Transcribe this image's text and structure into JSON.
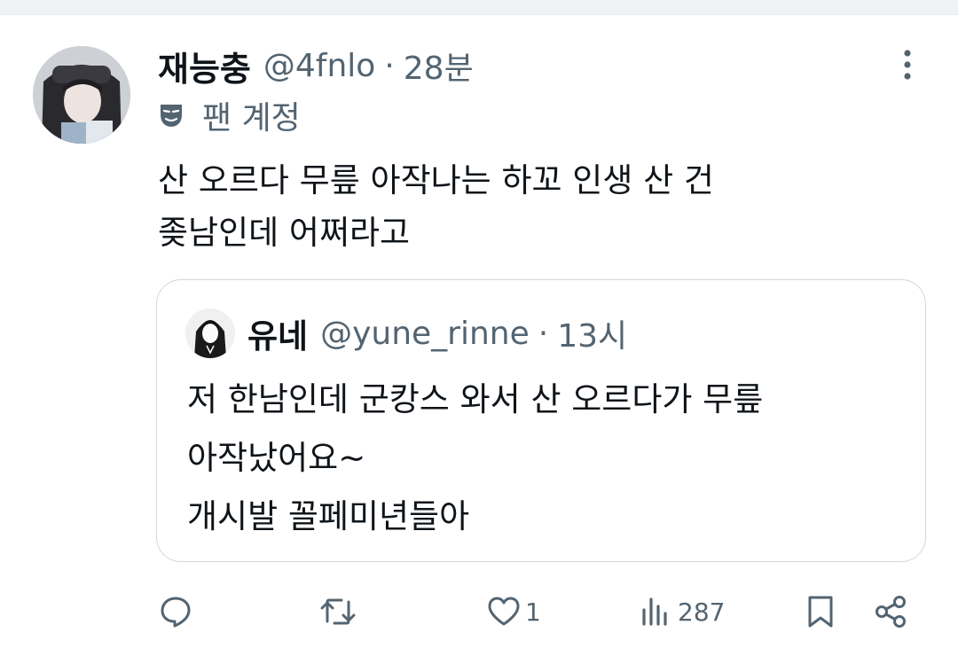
{
  "tweet": {
    "display_name": "재능충",
    "handle": "@4fnlo",
    "separator": "·",
    "time": "28분",
    "badge": "팬 계정",
    "text_lines": [
      "산 오르다 무릎 아작나는 하꼬 인생 산 건",
      "좆남인데 어쩌라고"
    ]
  },
  "quote": {
    "display_name": "유네",
    "handle": "@yune_rinne",
    "separator": "·",
    "time": "13시",
    "text_lines": [
      "저 한남인데 군캉스 와서 산 오르다가 무릎",
      "아작났어요~",
      "개시발 꼴페미년들아"
    ]
  },
  "actions": {
    "reply_count": "",
    "retweet_count": "",
    "like_count": "1",
    "views_count": "287"
  },
  "icons": {
    "more": "more-vertical-icon",
    "fan": "theater-mask-icon",
    "reply": "reply-icon",
    "retweet": "retweet-icon",
    "like": "heart-icon",
    "views": "views-chart-icon",
    "bookmark": "bookmark-icon",
    "share": "share-icon"
  },
  "colors": {
    "text": "#0f1419",
    "secondary": "#536471",
    "border": "#cfd9de"
  }
}
